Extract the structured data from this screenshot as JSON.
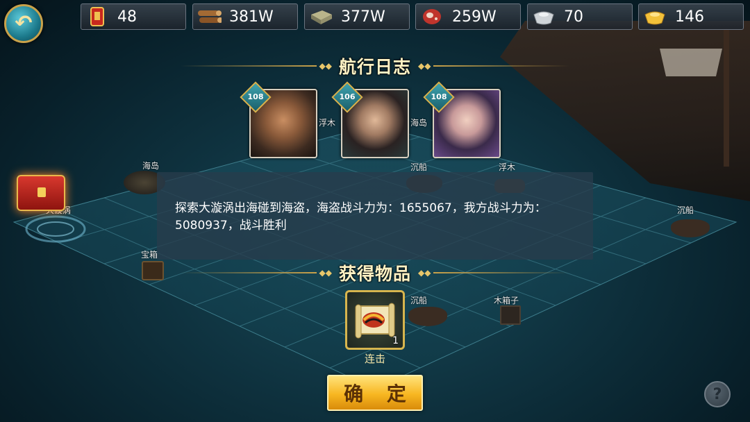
{
  "resources": [
    {
      "name": "token",
      "icon": "red-token-icon",
      "value": "48"
    },
    {
      "name": "wood",
      "icon": "wood-logs-icon",
      "value": "381W"
    },
    {
      "name": "stone",
      "icon": "stone-slab-icon",
      "value": "377W"
    },
    {
      "name": "meat",
      "icon": "meat-icon",
      "value": "259W"
    },
    {
      "name": "silver",
      "icon": "silver-ingot-icon",
      "value": "70"
    },
    {
      "name": "gold",
      "icon": "gold-ingot-icon",
      "value": "146"
    }
  ],
  "voyage_log_title": "航行日志",
  "heroes": [
    {
      "level": "108"
    },
    {
      "level": "106"
    },
    {
      "level": "108"
    }
  ],
  "message": "探索大漩涡出海碰到海盗，海盗战斗力为：1655067，我方战斗力为：5080937，战斗胜利",
  "rewards_title": "获得物品",
  "reward_item": {
    "name": "连击",
    "count": "1",
    "icon": "scroll-icon"
  },
  "confirm_label": "确 定",
  "help_label": "?",
  "map_labels": {
    "island_1": "海岛",
    "float_wood_1": "浮木",
    "island_2": "海岛",
    "whirlpool": "大漩涡",
    "wreck_1": "沉船",
    "float_wood_2": "浮木",
    "wreck_2": "沉船",
    "treasure": "宝箱",
    "wreck_3": "沉船",
    "wood_box": "木箱子",
    "wreck_4": "沉船"
  },
  "colors": {
    "accent_gold": "#c9a24a",
    "button_gold": "#f7b621",
    "sea_dark": "#0f3340"
  }
}
